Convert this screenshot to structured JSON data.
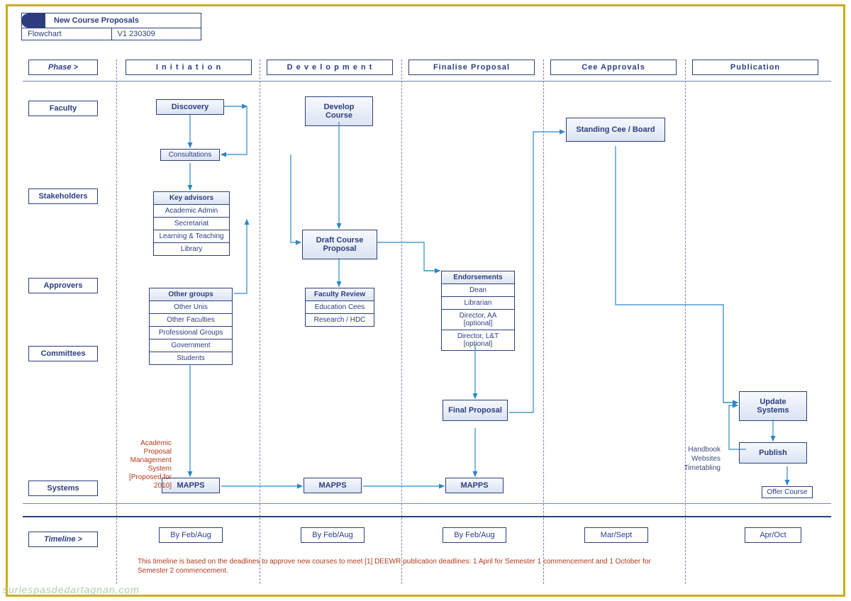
{
  "title": {
    "main": "New Course Proposals",
    "sub_left": "Flowchart",
    "sub_right": "V1 230309"
  },
  "phase_label": "Phase >",
  "columns": [
    "I n i t i a t i o n",
    "D e v e l o p m e n t",
    "Finalise Proposal",
    "Cee Approvals",
    "Publication"
  ],
  "rows": [
    "Faculty",
    "Stakeholders",
    "Approvers",
    "Committees",
    "Systems",
    "Timeline >"
  ],
  "initiation": {
    "discovery": "Discovery",
    "consultations": "Consultations",
    "stake": [
      "Key advisors",
      "Academic Admin",
      "Secretariat",
      "Learning & Teaching",
      "Library"
    ],
    "groups": [
      "Other groups",
      "Other Unis",
      "Other Faculties",
      "Professional Groups",
      "Government",
      "Students"
    ],
    "mapps": "MAPPS"
  },
  "development": {
    "develop": "Develop Course",
    "draft": "Draft Course Proposal",
    "reviews": [
      "Faculty Review",
      "Education Cees",
      "Research / HDC"
    ],
    "mapps": "MAPPS"
  },
  "finalise": {
    "endorse": [
      "Endorsements",
      "Dean",
      "Librarian",
      "Director, AA [optional]",
      "Director, L&T [optional]"
    ],
    "final": "Final Proposal",
    "mapps": "MAPPS"
  },
  "approvals": {
    "standing": "Standing Cee  / Board"
  },
  "publication": {
    "update": "Update Systems",
    "publish": "Publish",
    "offer": "Offer Course"
  },
  "side": {
    "apms": "Academic Proposal Management System [Proposed for 2010]",
    "hws": "Handbook Websites Timetabling"
  },
  "timeline": [
    "By Feb/Aug",
    "By Feb/Aug",
    "By Feb/Aug",
    "Mar/Sept",
    "Apr/Oct"
  ],
  "footnote": "This timeline is based on the deadlines to approve new courses to meet [1] DEEWR publication deadlines: 1 April for Semester 1 commencement and 1 October for Semester 2 commencement.",
  "watermark": "surlespasdedartagnan.com"
}
